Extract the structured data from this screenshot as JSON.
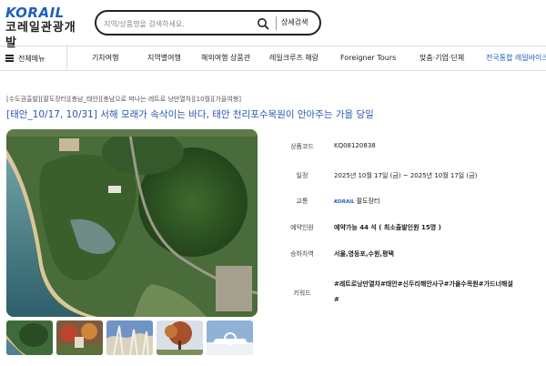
{
  "header": {
    "logo_top": "KORAIL",
    "logo_bottom": "코레일관광개발",
    "search_placeholder": "지역/상품명을 검색하세요.",
    "detail_search": "상세검색"
  },
  "nav": {
    "all_menu": "전체메뉴",
    "items": [
      "기차여행",
      "지역별여행",
      "해외여행 상품관",
      "레일크루즈 해랑",
      "Foreigner Tours",
      "맞춤·기업·단체",
      "전국통합 레일바이크"
    ]
  },
  "breadcrumb": "[수도권출발][팔도장터][충남_태안][충남으로 떠나는 레트로 낭만열차][10월][가을여행]",
  "title": "[태안_10/17, 10/31] 서해 모래가 속삭이는 바다, 태안 천리포수목원이 안아주는 가을 당일",
  "info": {
    "product_code_label": "상품코드",
    "product_code": "KQ08120838",
    "schedule_label": "일정",
    "schedule": "2025년 10월 17일 (금) ~ 2025년 10월 17일 (금)",
    "transport_label": "교통",
    "transport_logo": "KORAIL",
    "transport": "팔도장터",
    "reservation_label": "예약인원",
    "reservation": "예약가능 44 석 ( 최소출발인원 15명 )",
    "boarding_label": "승하차역",
    "boarding": "서울,영등포,수원,평택",
    "keyword_label": "키워드",
    "keywords": "#레트로낭만열차#태안#신두리해안사구#가을수목원#가드너해설",
    "keywords_extra": "#"
  }
}
